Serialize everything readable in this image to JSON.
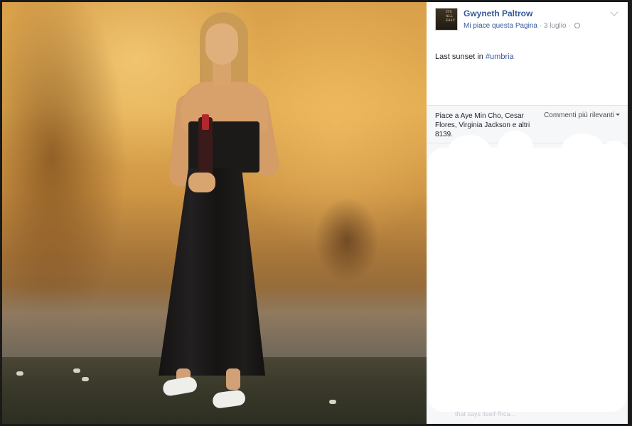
{
  "post": {
    "author": "Gwyneth Paltrow",
    "like_page_link": "Mi piace questa Pagina",
    "separator": " · ",
    "date": "3 luglio",
    "separator2": " · ",
    "text_prefix": "Last sunset in ",
    "hashtag": "#umbria",
    "avatar_text": "IT'S ALL EASY"
  },
  "reactions": {
    "likes_text": "Piace a Aye Min Cho, Cesar Flores, Virginia Jackson e altri 8139.",
    "comments_sort_label": "Commenti più rilevanti"
  },
  "comments": {
    "faint_text": "that says itself Rica..."
  },
  "icons": {
    "avatar": "profile-photo",
    "globe": "globe-icon",
    "chevron": "chevron-down-icon",
    "sort_caret": "caret-down-icon"
  },
  "colors": {
    "link_blue": "#365899",
    "meta_gray": "#90949c",
    "text_dark": "#1d2129",
    "panel_bg": "#ffffff",
    "bar_bg": "#f6f7f9"
  }
}
